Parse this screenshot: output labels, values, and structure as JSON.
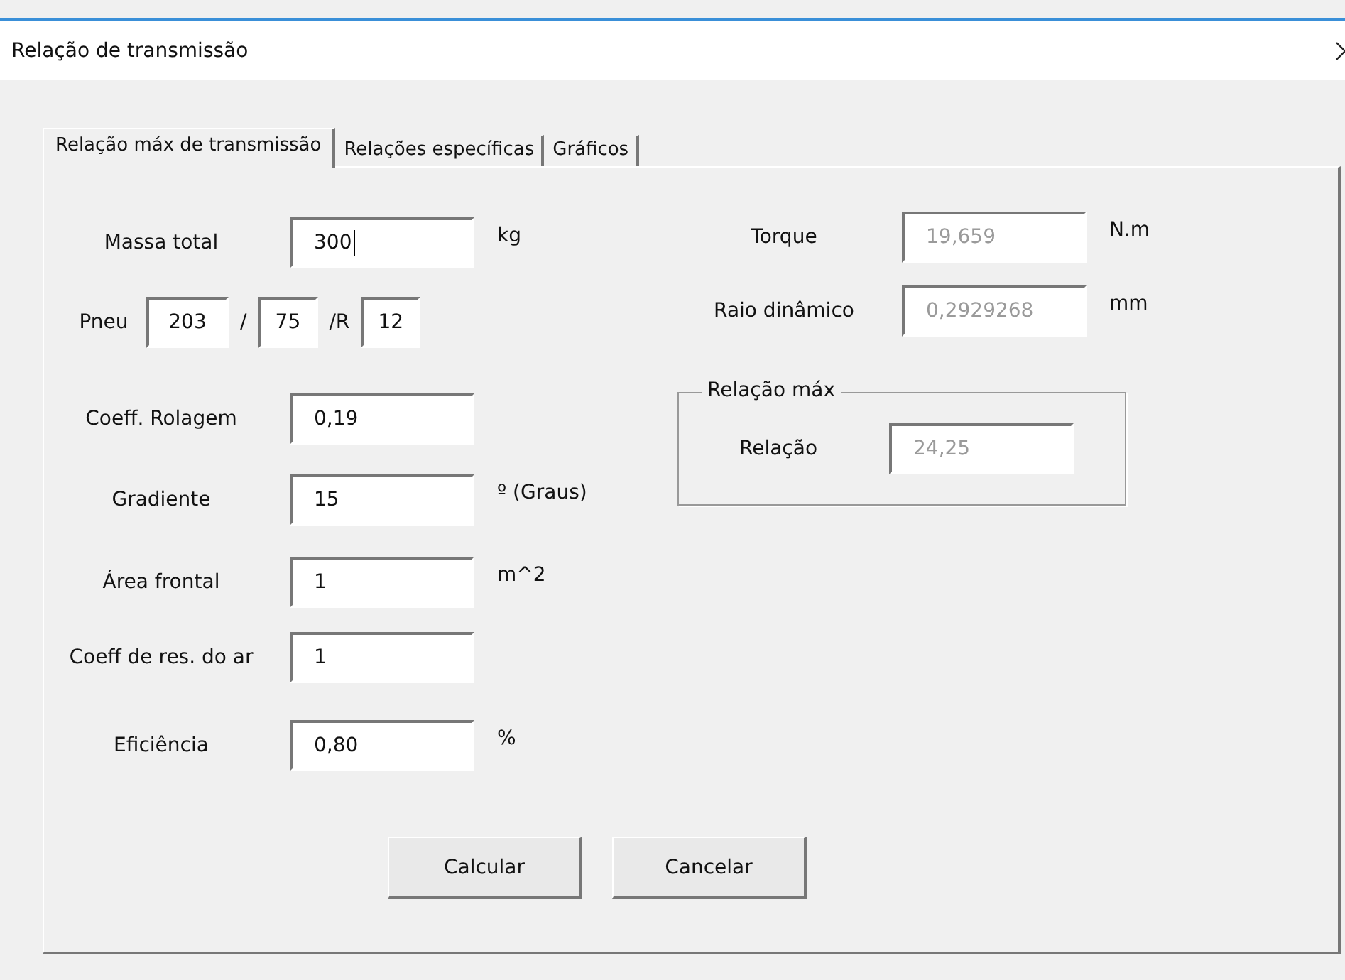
{
  "window": {
    "title": "Relação de transmissão"
  },
  "tabs": [
    {
      "label": "Relação máx de transmissão",
      "selected": true
    },
    {
      "label": "Relações específicas",
      "selected": false
    },
    {
      "label": "Gráficos",
      "selected": false
    }
  ],
  "inputs": [
    {
      "kind": "field",
      "label": "Massa total",
      "value": "300",
      "unit": "kg",
      "focused": true
    },
    {
      "kind": "tire",
      "label": "Pneu",
      "parts": [
        {
          "value": "203",
          "separator": "/"
        },
        {
          "value": "75",
          "separator": "/R"
        },
        {
          "value": "12"
        }
      ]
    },
    {
      "kind": "field",
      "label": "Coeff. Rolagem",
      "value": "0,19",
      "focused": false
    },
    {
      "kind": "field",
      "label": "Gradiente",
      "value": "15",
      "unit": "º (Graus)",
      "focused": false
    },
    {
      "kind": "field",
      "label": "Área frontal",
      "value": "1",
      "unit": "m^2",
      "focused": false
    },
    {
      "kind": "field",
      "label": "Coeff de res. do ar",
      "value": "1",
      "focused": false
    },
    {
      "kind": "field",
      "label": "Eficiência",
      "value": "0,80",
      "unit": "%",
      "focused": false
    }
  ],
  "results": [
    {
      "label": "Torque",
      "value": "19,659",
      "unit": "N.m",
      "disabled": true
    },
    {
      "label": "Raio dinâmico",
      "value": "0,2929268",
      "unit": "mm",
      "disabled": true
    }
  ],
  "group": {
    "title": "Relação máx",
    "label": "Relação",
    "value": "24,25",
    "disabled": true
  },
  "buttons": [
    "Calcular",
    "Cancelar"
  ]
}
